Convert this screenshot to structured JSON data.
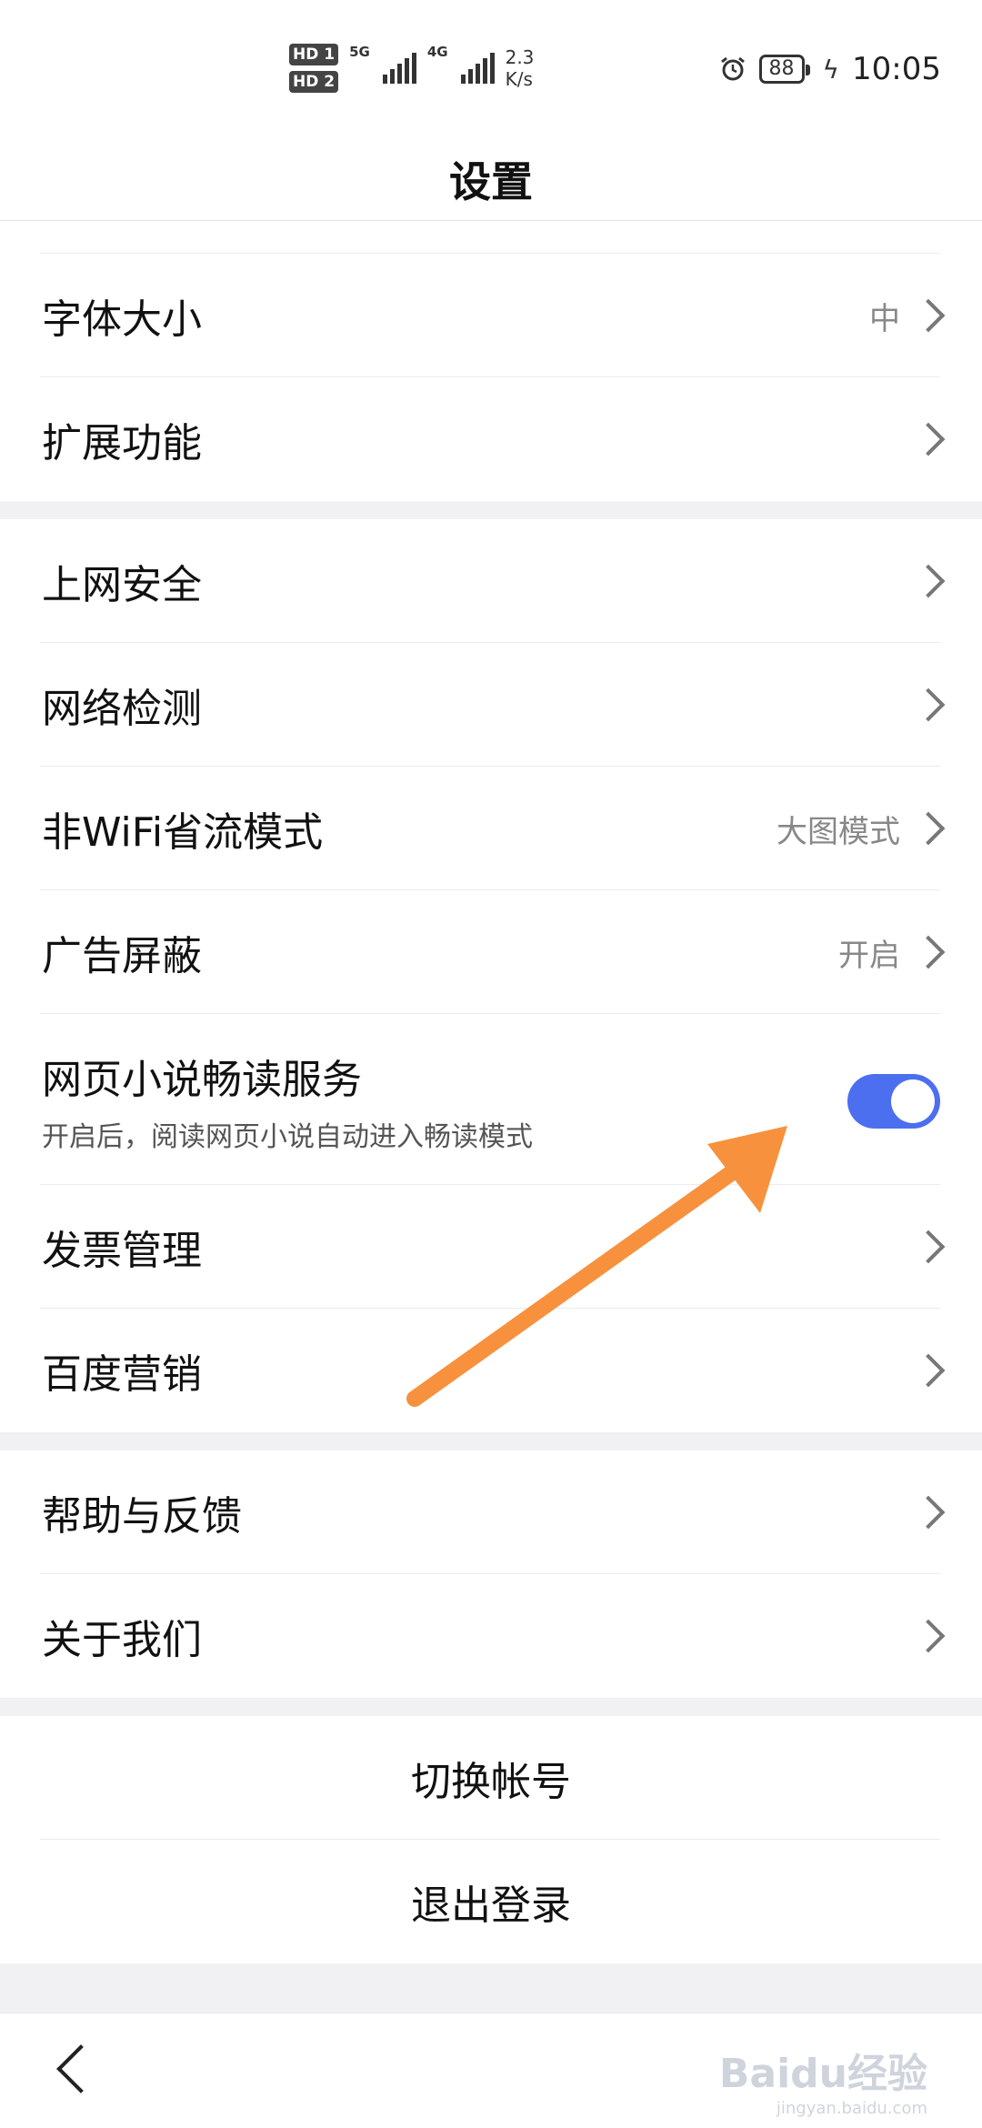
{
  "status_bar": {
    "hd1": "HD 1",
    "hd2": "HD 2",
    "net1": "5G",
    "net2": "4G",
    "speed_value": "2.3",
    "speed_unit": "K/s",
    "battery": "88",
    "time": "10:05"
  },
  "header": {
    "title": "设置"
  },
  "group1": {
    "items": [
      {
        "label": "字体大小",
        "value": "中"
      },
      {
        "label": "扩展功能"
      }
    ]
  },
  "group2": {
    "items": [
      {
        "label": "上网安全"
      },
      {
        "label": "网络检测"
      },
      {
        "label": "非WiFi省流模式",
        "value": "大图模式"
      },
      {
        "label": "广告屏蔽",
        "value": "开启"
      }
    ],
    "novel": {
      "label": "网页小说畅读服务",
      "description": "开启后，阅读网页小说自动进入畅读模式",
      "enabled": true
    },
    "items2": [
      {
        "label": "发票管理"
      },
      {
        "label": "百度营销"
      }
    ]
  },
  "group3": {
    "items": [
      {
        "label": "帮助与反馈"
      },
      {
        "label": "关于我们"
      }
    ]
  },
  "account": {
    "switch_label": "切换帐号",
    "logout_label": "退出登录"
  },
  "annotation": {
    "color": "#f7913d"
  },
  "accent_color": "#4c6ff0",
  "watermark": {
    "brand": "Baidu经验",
    "url": "jingyan.baidu.com"
  }
}
